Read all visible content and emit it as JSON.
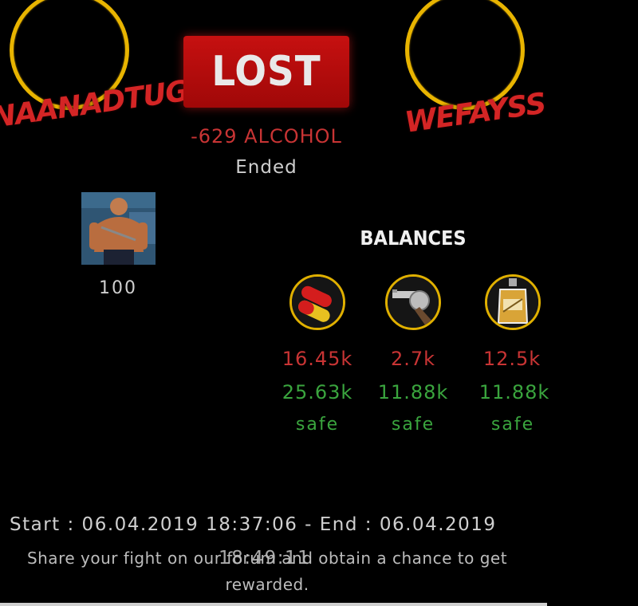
{
  "players": {
    "left": {
      "name": "NAANADTUG"
    },
    "right": {
      "name": "WEFAYSS"
    }
  },
  "result": {
    "label": "LOST",
    "delta": "-629 ALCOHOL",
    "status": "Ended"
  },
  "unit": {
    "icon": "fighter-avatar",
    "count": "100"
  },
  "balances": {
    "title": "BALANCES",
    "resources": [
      {
        "icon": "pills-icon",
        "lost": "16.45k",
        "safe_value": "25.63k",
        "safe_label": "safe"
      },
      {
        "icon": "revolver-icon",
        "lost": "2.7k",
        "safe_value": "11.88k",
        "safe_label": "safe"
      },
      {
        "icon": "whiskey-decanter-icon",
        "lost": "12.5k",
        "safe_value": "11.88k",
        "safe_label": "safe"
      }
    ]
  },
  "footer": {
    "dates_line": "Start : 06.04.2019 18:37:06 - End : 06.04.2019",
    "dates_line2": "18:49:11",
    "share": "Share your fight on our forum and obtain a chance to get rewarded."
  },
  "colors": {
    "accent_red": "#c83434",
    "accent_green": "#3aa53e",
    "ring_gold": "#e8b400"
  }
}
